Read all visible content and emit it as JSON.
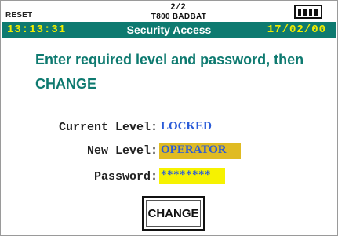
{
  "topbar": {
    "reset_label": "RESET",
    "page_indicator": "2/2",
    "device_name": "T800 BADBAT"
  },
  "titlebar": {
    "time": "13:13:31",
    "title": "Security Access",
    "date": "17/02/00"
  },
  "instruction": "Enter required level and password, then CHANGE",
  "fields": {
    "current_level": {
      "label": "Current Level:",
      "value": "LOCKED"
    },
    "new_level": {
      "label": "New Level:",
      "value": "OPERATOR"
    },
    "password": {
      "label": "Password:",
      "value": "********"
    }
  },
  "change_button_label": "CHANGE",
  "colors": {
    "accent": "#0e7a70",
    "time_text": "#f2ec00",
    "value_text": "#2a5bd8",
    "new_level_highlight": "#e0bb22",
    "password_highlight": "#f6f200"
  },
  "icons": {
    "battery": "battery-icon"
  }
}
